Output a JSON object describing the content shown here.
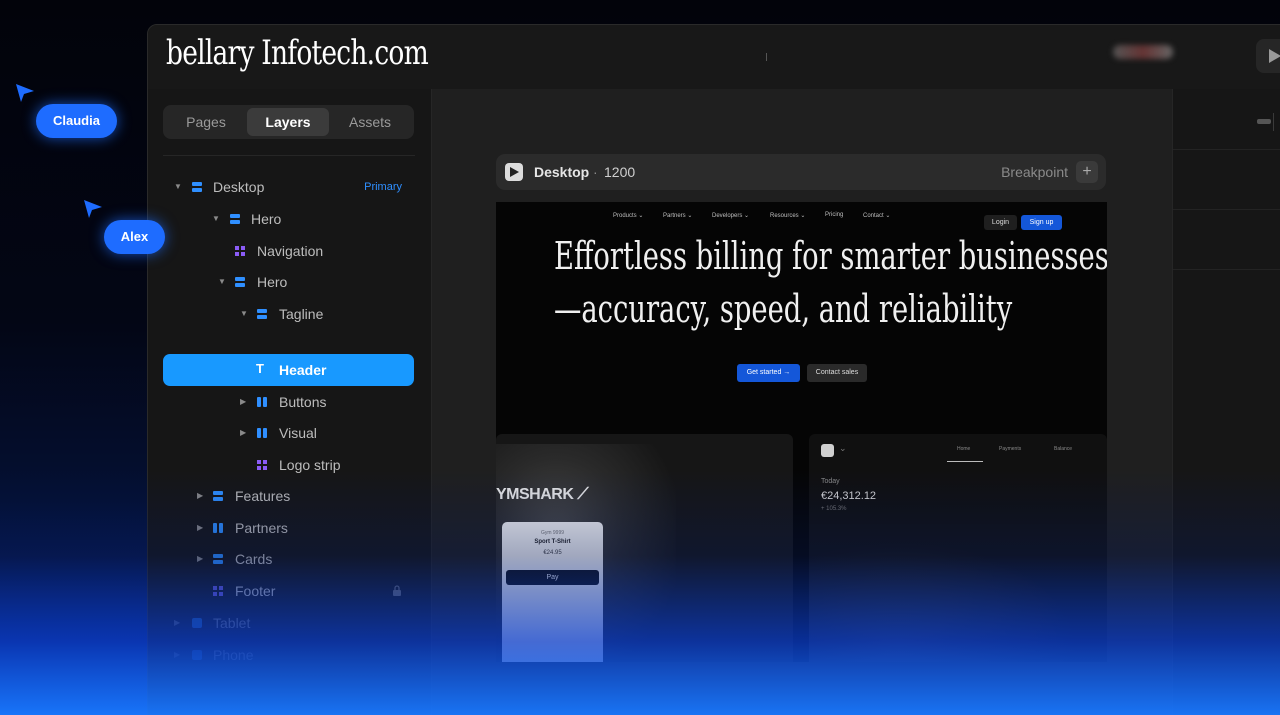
{
  "topbar": {
    "brand": "bellary Infotech.com"
  },
  "sidebar": {
    "tabs": [
      "Pages",
      "Layers",
      "Assets"
    ],
    "active_tab": "Layers",
    "layers": [
      {
        "label": "Desktop",
        "tag": "Primary",
        "icon": "stack-icon",
        "expanded": true
      },
      {
        "label": "Hero",
        "icon": "stack-icon",
        "expanded": true
      },
      {
        "label": "Navigation",
        "icon": "component-icon"
      },
      {
        "label": "Hero",
        "icon": "stack-icon",
        "expanded": true
      },
      {
        "label": "Tagline",
        "icon": "stack-icon",
        "expanded": true
      },
      {
        "label": "Header",
        "icon": "text-icon",
        "selected": true
      },
      {
        "label": "Buttons",
        "icon": "columns-icon",
        "expanded": false
      },
      {
        "label": "Visual",
        "icon": "columns-icon",
        "expanded": false
      },
      {
        "label": "Logo strip",
        "icon": "component-icon"
      },
      {
        "label": "Features",
        "icon": "stack-icon",
        "expanded": false
      },
      {
        "label": "Partners",
        "icon": "columns-icon",
        "expanded": false
      },
      {
        "label": "Cards",
        "icon": "stack-icon",
        "expanded": false
      },
      {
        "label": "Footer",
        "icon": "component-icon",
        "locked": true
      },
      {
        "label": "Tablet",
        "extra": "",
        "icon": "frame-icon",
        "expanded": false
      },
      {
        "label": "Phone",
        "extra": "",
        "icon": "frame-icon",
        "expanded": false
      }
    ]
  },
  "canvas": {
    "breakpoint_bar": {
      "title": "Desktop",
      "separator": "·",
      "size": "1200",
      "breakpoint_label": "Breakpoint",
      "add": "+"
    },
    "preview": {
      "nav_items": [
        "Products ⌄",
        "Partners ⌄",
        "Developers ⌄",
        "Resources ⌄",
        "Pricing",
        "Contact ⌄"
      ],
      "login": "Login",
      "signup": "Sign up",
      "headline_line1": "Effortless billing for smarter businesses",
      "headline_line2": "—accuracy, speed, and reliability",
      "cta_primary": "Get started →",
      "cta_secondary": "Contact sales",
      "gym_logo": "YMSHARK ⟋",
      "pay_card": {
        "line1": "Gym 9999",
        "product": "Sport T-Shirt",
        "price": "€24.95",
        "pay_button": " Pay"
      },
      "dashboard": {
        "tabs": [
          "Home",
          "Payments",
          "Balance"
        ],
        "today_label": "Today",
        "amount": "€24,312.12",
        "delta": "+ 105.3%"
      }
    }
  },
  "collaborators": [
    {
      "name": "Claudia"
    },
    {
      "name": "Alex"
    }
  ],
  "colors": {
    "accent": "#1899ff",
    "brand_blue": "#1e6cff",
    "sign_up": "#1457d9",
    "primary_tag": "#2f8fff"
  }
}
